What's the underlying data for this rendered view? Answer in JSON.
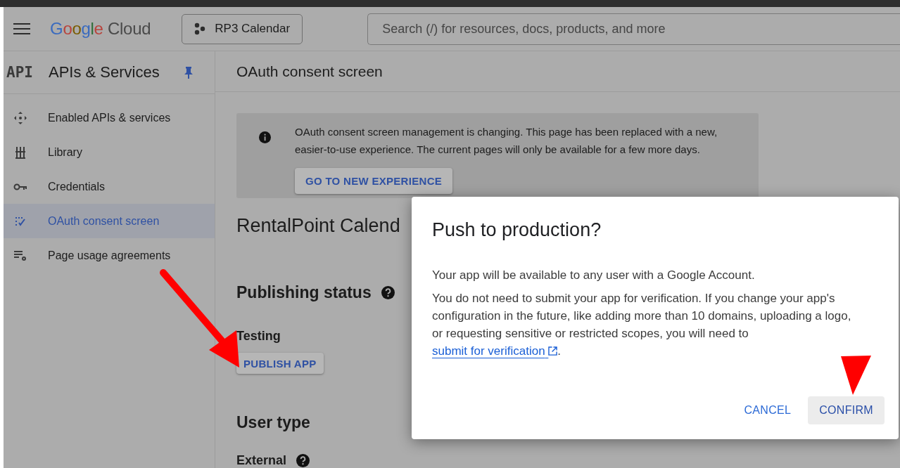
{
  "header": {
    "logo": {
      "brand": "Google",
      "product": "Cloud"
    },
    "project": "RP3 Calendar",
    "search": {
      "placeholder": "Search (/) for resources, docs, products, and more"
    }
  },
  "sidebar": {
    "badge": "API",
    "title": "APIs & Services",
    "pinned": true,
    "items": [
      {
        "label": "Enabled APIs & services",
        "selected": false
      },
      {
        "label": "Library",
        "selected": false
      },
      {
        "label": "Credentials",
        "selected": false
      },
      {
        "label": "OAuth consent screen",
        "selected": true
      },
      {
        "label": "Page usage agreements",
        "selected": false
      }
    ]
  },
  "main": {
    "title": "OAuth consent screen",
    "banner": {
      "text": "OAuth consent screen management is changing. This page has been replaced with a new, easier-to-use experience. The current pages will only be available for a few more days.",
      "button": "GO TO NEW EXPERIENCE"
    },
    "app_name": "RentalPoint Calend",
    "publishing_status": {
      "heading": "Publishing status",
      "status": "Testing",
      "button": "PUBLISH APP"
    },
    "user_type": {
      "heading": "User type",
      "value": "External"
    }
  },
  "dialog": {
    "title": "Push to production?",
    "intro": "Your app will be available to any user with a Google Account.",
    "body_before": "You do not need to submit your app for verification. If you change your app's configuration in the future, like adding more than 10 domains, uploading a logo, or requesting sensitive or restricted scopes, you will need to ",
    "link": "submit for verification",
    "body_after": ".",
    "buttons": [
      {
        "label": "CANCEL",
        "kind": "text"
      },
      {
        "label": "CONFIRM",
        "kind": "filled"
      }
    ]
  }
}
